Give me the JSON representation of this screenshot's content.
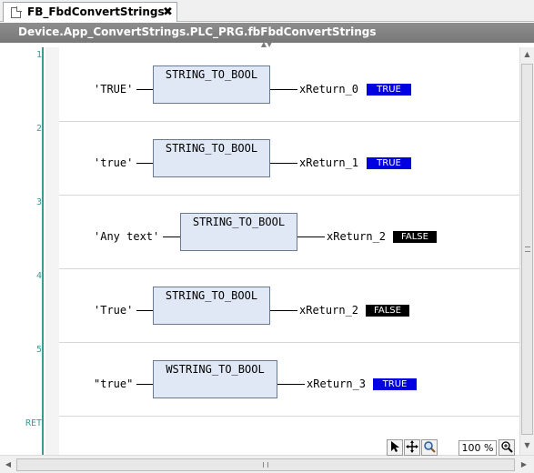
{
  "tab": {
    "title": "FB_FbdConvertStrings",
    "close_glyph": "✖",
    "icon": "document-icon"
  },
  "breadcrumb": {
    "path": "Device.App_ConvertStrings.PLC_PRG.fbFbdConvertStrings"
  },
  "networks": [
    {
      "number": "1",
      "input": "'TRUE'",
      "block": "STRING_TO_BOOL",
      "output": "xReturn_0",
      "value": "TRUE",
      "value_color": "#0000e0"
    },
    {
      "number": "2",
      "input": "'true'",
      "block": "STRING_TO_BOOL",
      "output": "xReturn_1",
      "value": "TRUE",
      "value_color": "#0000e0"
    },
    {
      "number": "3",
      "input": "'Any text'",
      "block": "STRING_TO_BOOL",
      "output": "xReturn_2",
      "value": "FALSE",
      "value_color": "#000000"
    },
    {
      "number": "4",
      "input": "'True'",
      "block": "STRING_TO_BOOL",
      "output": "xReturn_2",
      "value": "FALSE",
      "value_color": "#000000"
    },
    {
      "number": "5",
      "input": "\"true\"",
      "block": "WSTRING_TO_BOOL",
      "output": "xReturn_3",
      "value": "TRUE",
      "value_color": "#0000e0"
    }
  ],
  "ret_label": "RET",
  "toolbar": {
    "pointer_icon": "pointer-icon",
    "move_icon": "move-icon",
    "zoom_icon": "magnifier-icon",
    "zoom_level": "100 %",
    "zoom_options_icon": "zoom-options-icon"
  },
  "colors": {
    "gutter_accent": "#3e9b94",
    "true_badge": "#0000e0",
    "false_badge": "#000000",
    "block_fill": "#e0e8f6"
  }
}
